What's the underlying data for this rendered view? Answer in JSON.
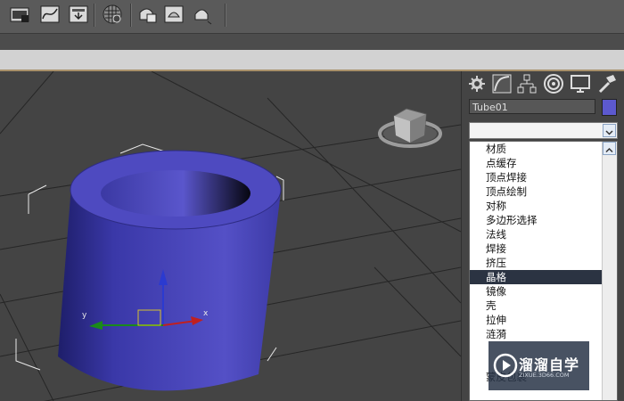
{
  "toolbar": {
    "buttons": [
      {
        "name": "layer-manager-icon"
      },
      {
        "name": "curve-editor-icon"
      },
      {
        "name": "schematic-view-icon"
      },
      {
        "name": "material-editor-icon"
      },
      {
        "name": "render-setup-icon"
      },
      {
        "name": "rendered-frame-window-icon"
      },
      {
        "name": "render-production-icon"
      }
    ]
  },
  "scene": {
    "object_color": "#5c59cf",
    "axis_labels": {
      "x": "x",
      "y": "y"
    }
  },
  "panel": {
    "tabs": [
      "create-tab",
      "modify-tab",
      "hierarchy-tab",
      "motion-tab",
      "display-tab",
      "utilities-tab"
    ],
    "object_name": "Tube01",
    "modifier_list_value": "",
    "modifier_list_items": [
      "材质",
      "点缓存",
      "顶点焊接",
      "顶点绘制",
      "对称",
      "多边形选择",
      "法线",
      "焊接",
      "挤压",
      "晶格",
      "镜像",
      "壳",
      "拉伸",
      "涟漪",
      "",
      "",
      "蒙皮包裹"
    ],
    "selected_index": 9
  },
  "watermark": {
    "title": "溜溜自学",
    "subtitle": "ZIXUE.3D66.COM"
  }
}
